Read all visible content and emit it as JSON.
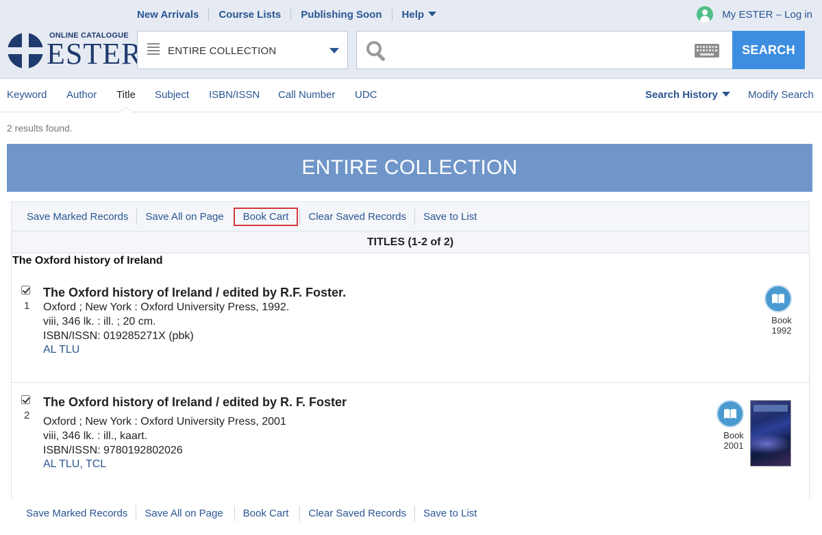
{
  "header": {
    "logo_small": "ONLINE CATALOGUE",
    "logo_big": "ESTER",
    "nav": [
      "New Arrivals",
      "Course Lists",
      "Publishing Soon",
      "Help"
    ],
    "login": "My ESTER – Log in",
    "scope": "ENTIRE COLLECTION",
    "search_placeholder": "",
    "search_button": "SEARCH"
  },
  "tabs": {
    "items": [
      "Keyword",
      "Author",
      "Title",
      "Subject",
      "ISBN/ISSN",
      "Call Number",
      "UDC"
    ],
    "active": "Title",
    "history": "Search History",
    "modify": "Modify Search"
  },
  "results": {
    "count_text": "2 results found.",
    "banner": "ENTIRE COLLECTION",
    "toolbar": [
      "Save Marked Records",
      "Save All on Page",
      "Book Cart",
      "Clear Saved Records",
      "Save to List"
    ],
    "titles_bar": "TITLES (1-2 of 2)",
    "group_heading": "The Oxford history of Ireland",
    "records": [
      {
        "num": "1",
        "title": "The Oxford history of Ireland / edited by R.F. Foster.",
        "publication": "Oxford ; New York : Oxford University Press, 1992.",
        "physical": "viii, 346 lk. : ill. ; 20 cm.",
        "isbn": "ISBN/ISSN:  019285271X (pbk)",
        "location": "AL TLU",
        "format": "Book",
        "year": "1992"
      },
      {
        "num": "2",
        "title": "The Oxford history of Ireland / edited by R. F. Foster",
        "publication": "Oxford ; New York : Oxford University Press, 2001",
        "physical": "viii, 346 lk. : ill., kaart.",
        "isbn": "ISBN/ISSN:  9780192802026",
        "location": "AL TLU, TCL",
        "format": "Book",
        "year": "2001"
      }
    ]
  },
  "colors": {
    "accent": "#2a5591",
    "banner": "#7096c9",
    "search_button": "#3d8ee0",
    "highlight": "#d6383a"
  },
  "icons": [
    "ester-logo-icon",
    "user-icon",
    "list-icon",
    "search-icon",
    "keyboard-icon",
    "book-icon",
    "book-cover-image"
  ]
}
